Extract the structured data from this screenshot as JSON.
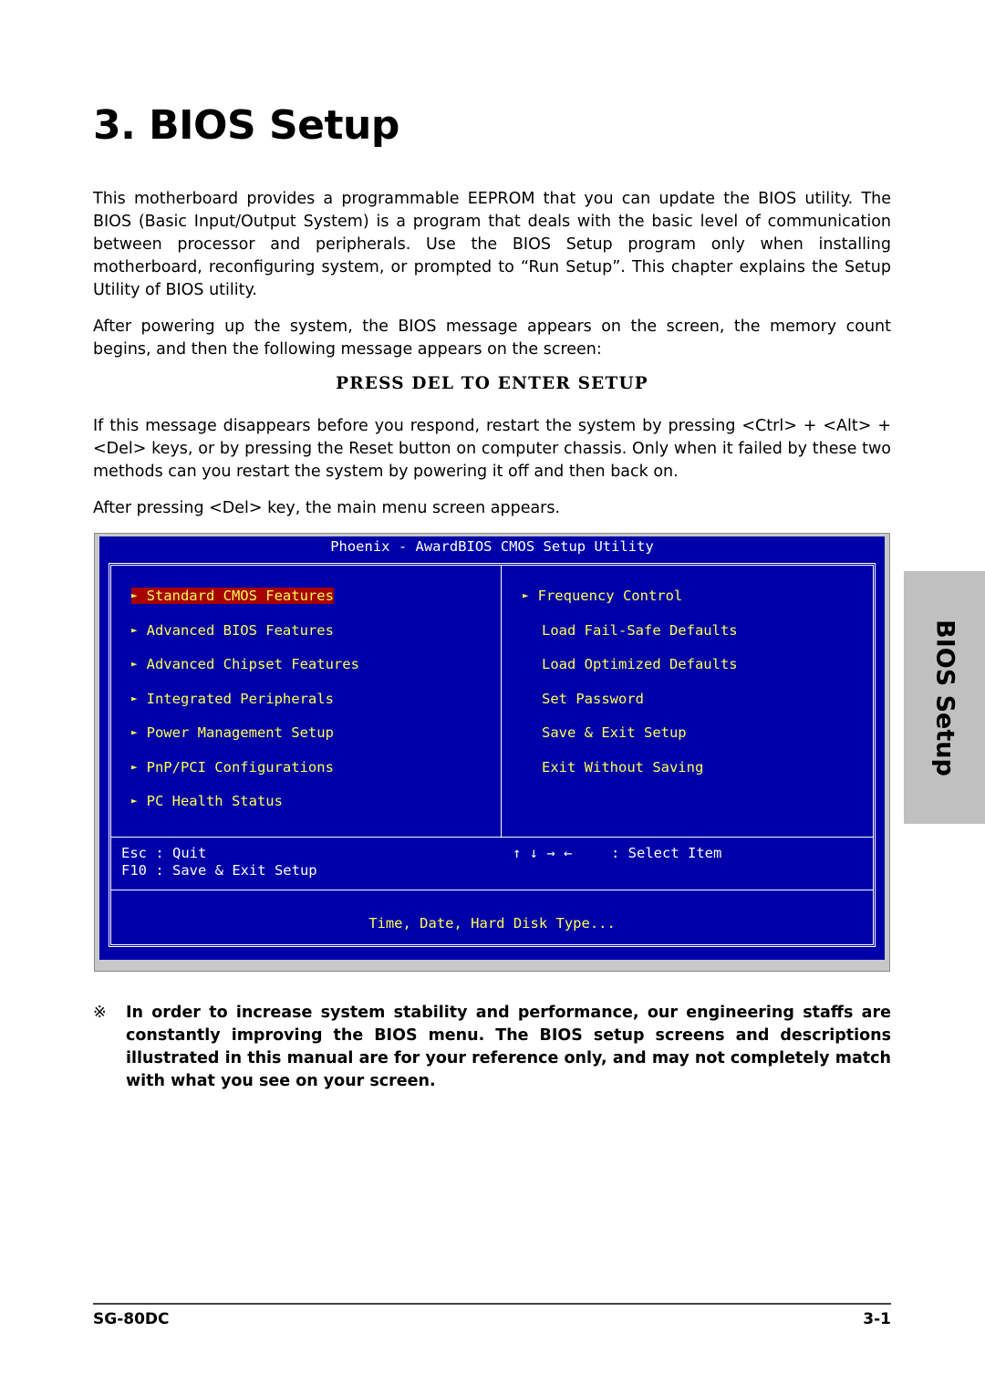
{
  "page": {
    "title": "3. BIOS Setup",
    "paragraphs": [
      "This motherboard provides a programmable EEPROM that you can update the BIOS utility. The BIOS (Basic Input/Output System) is a program that deals with the basic level of communication between processor and peripherals. Use the BIOS Setup program only when installing motherboard, reconfiguring system, or prompted to “Run Setup”. This chapter explains the Setup Utility of BIOS utility.",
      "After powering up the system, the BIOS message appears on the screen, the memory count begins, and then the following message appears on the screen:",
      "If this message disappears before you respond, restart the system by pressing <Ctrl> + <Alt> + <Del> keys, or by pressing the Reset button on computer chassis. Only when it failed by these two methods can you restart the system by powering it off and then back on.",
      "After pressing <Del> key, the main menu screen appears."
    ],
    "press_message": "PRESS DEL TO ENTER SETUP",
    "side_tab": "BIOS Setup",
    "note_mark": "※",
    "note": "In order to increase system stability and performance, our engineering staffs are constantly improving the BIOS menu. The BIOS setup screens and descriptions illustrated in this manual are for your reference only, and may not completely match with what you see on your screen.",
    "footer": {
      "model": "SG-80DC",
      "page_number": "3-1"
    }
  },
  "bios": {
    "title": "Phoenix - AwardBIOS CMOS Setup Utility",
    "arrow_glyph": "►",
    "left_menu": [
      {
        "label": "Standard CMOS Features",
        "arrow": true,
        "selected": true
      },
      {
        "label": "Advanced BIOS Features",
        "arrow": true
      },
      {
        "label": "Advanced Chipset Features",
        "arrow": true
      },
      {
        "label": "Integrated Peripherals",
        "arrow": true
      },
      {
        "label": "Power Management Setup",
        "arrow": true
      },
      {
        "label": "PnP/PCI Configurations",
        "arrow": true
      },
      {
        "label": "PC Health Status",
        "arrow": true
      }
    ],
    "right_menu": [
      {
        "label": "Frequency Control",
        "arrow": true
      },
      {
        "label": "Load Fail-Safe Defaults",
        "arrow": false
      },
      {
        "label": "Load Optimized Defaults",
        "arrow": false
      },
      {
        "label": "Set Password",
        "arrow": false
      },
      {
        "label": "Save & Exit Setup",
        "arrow": false
      },
      {
        "label": "Exit Without Saving",
        "arrow": false
      }
    ],
    "help": {
      "esc": "Esc : Quit",
      "f10": "F10 : Save & Exit Setup",
      "arrows": "↑ ↓ → ←",
      "select": ": Select Item"
    },
    "description": "Time, Date, Hard Disk Type...",
    "colors": {
      "background": "#0000a8",
      "highlight": "#a80000",
      "text": "#ffff55"
    }
  }
}
